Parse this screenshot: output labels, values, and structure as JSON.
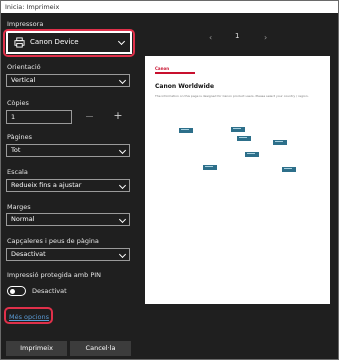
{
  "window": {
    "title": "Inicia: Imprimeix"
  },
  "printer": {
    "label": "Impressora",
    "value": "Canon Device"
  },
  "orientation": {
    "label": "Orientació",
    "value": "Vertical"
  },
  "copies": {
    "label": "Còpies",
    "value": "1"
  },
  "pages": {
    "label": "Pàgines",
    "value": "Tot"
  },
  "scale": {
    "label": "Escala",
    "value": "Redueix fins a ajustar"
  },
  "margins": {
    "label": "Marges",
    "value": "Normal"
  },
  "headers": {
    "label": "Capçaleres i peus de pàgina",
    "value": "Desactivat"
  },
  "pin": {
    "label": "Impressió protegida amb PIN",
    "toggle_text": "Desactivat",
    "toggle_on": false
  },
  "more_link": "Més opcions",
  "buttons": {
    "print": "Imprimeix",
    "cancel": "Cancel·la"
  },
  "preview": {
    "page_number": "1",
    "doc_logo": "Canon",
    "doc_title": "Canon Worldwide",
    "doc_body": "The information on this page is designed for Canon product users. Please select your country / region."
  },
  "colors": {
    "highlight": "#e0304a",
    "link": "#5b9bd5",
    "background": "#1f1f1f"
  }
}
